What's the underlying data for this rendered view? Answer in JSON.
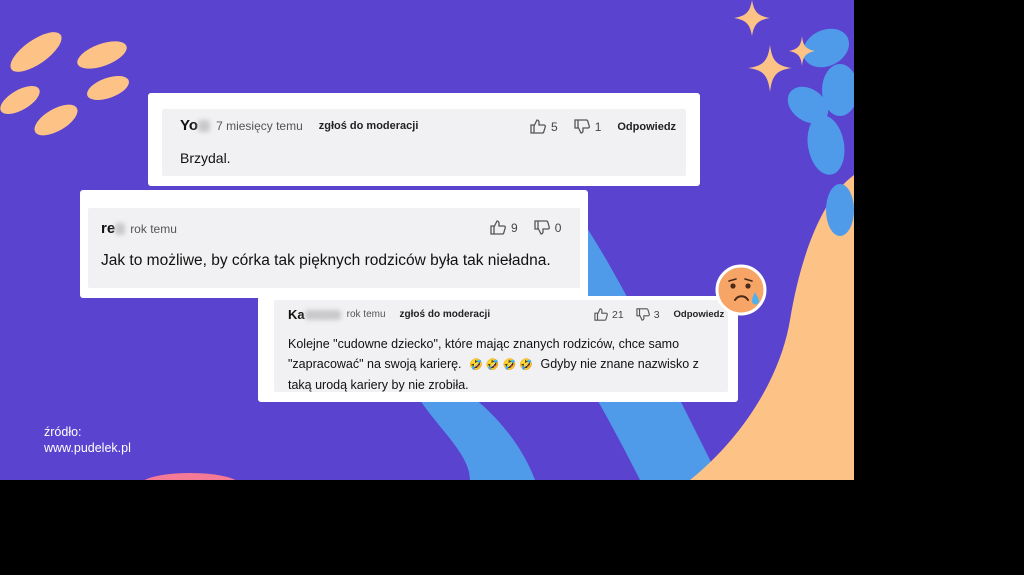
{
  "comments": [
    {
      "username": "Yo",
      "time": "7 miesięcy temu",
      "report": "zgłoś do moderacji",
      "likes": "5",
      "dislikes": "1",
      "reply": "Odpowiedz",
      "text": "Brzydal."
    },
    {
      "username": "re",
      "time": "rok temu",
      "likes": "9",
      "dislikes": "0",
      "text": "Jak to możliwe, by córka tak pięknych rodziców była tak nieładna."
    },
    {
      "username": "Ka",
      "time": "rok temu",
      "report": "zgłoś do moderacji",
      "likes": "21",
      "dislikes": "3",
      "reply": "Odpowiedz",
      "text_line1": "Kolejne \"cudowne dziecko\", które mając znanych rodziców, chce samo",
      "text_line2_start": "\"zapracować\" na swoją karierę.",
      "emojis": "🤣 🤣 🤣 🤣",
      "text_line2_end": "Gdyby nie znane nazwisko z",
      "text_line3": "taką urodą kariery by nie zrobiła."
    }
  ],
  "source": {
    "label": "źródło:",
    "url": "www.pudelek.pl"
  },
  "colors": {
    "background": "#5a43cf",
    "shape_blue": "#4f9bea",
    "shape_peach": "#fdc386",
    "sparkle": "#fdc386"
  },
  "icons": [
    "thumbs-up-icon",
    "thumbs-down-icon",
    "sad-tear-emoji-icon",
    "sparkle-icon"
  ]
}
